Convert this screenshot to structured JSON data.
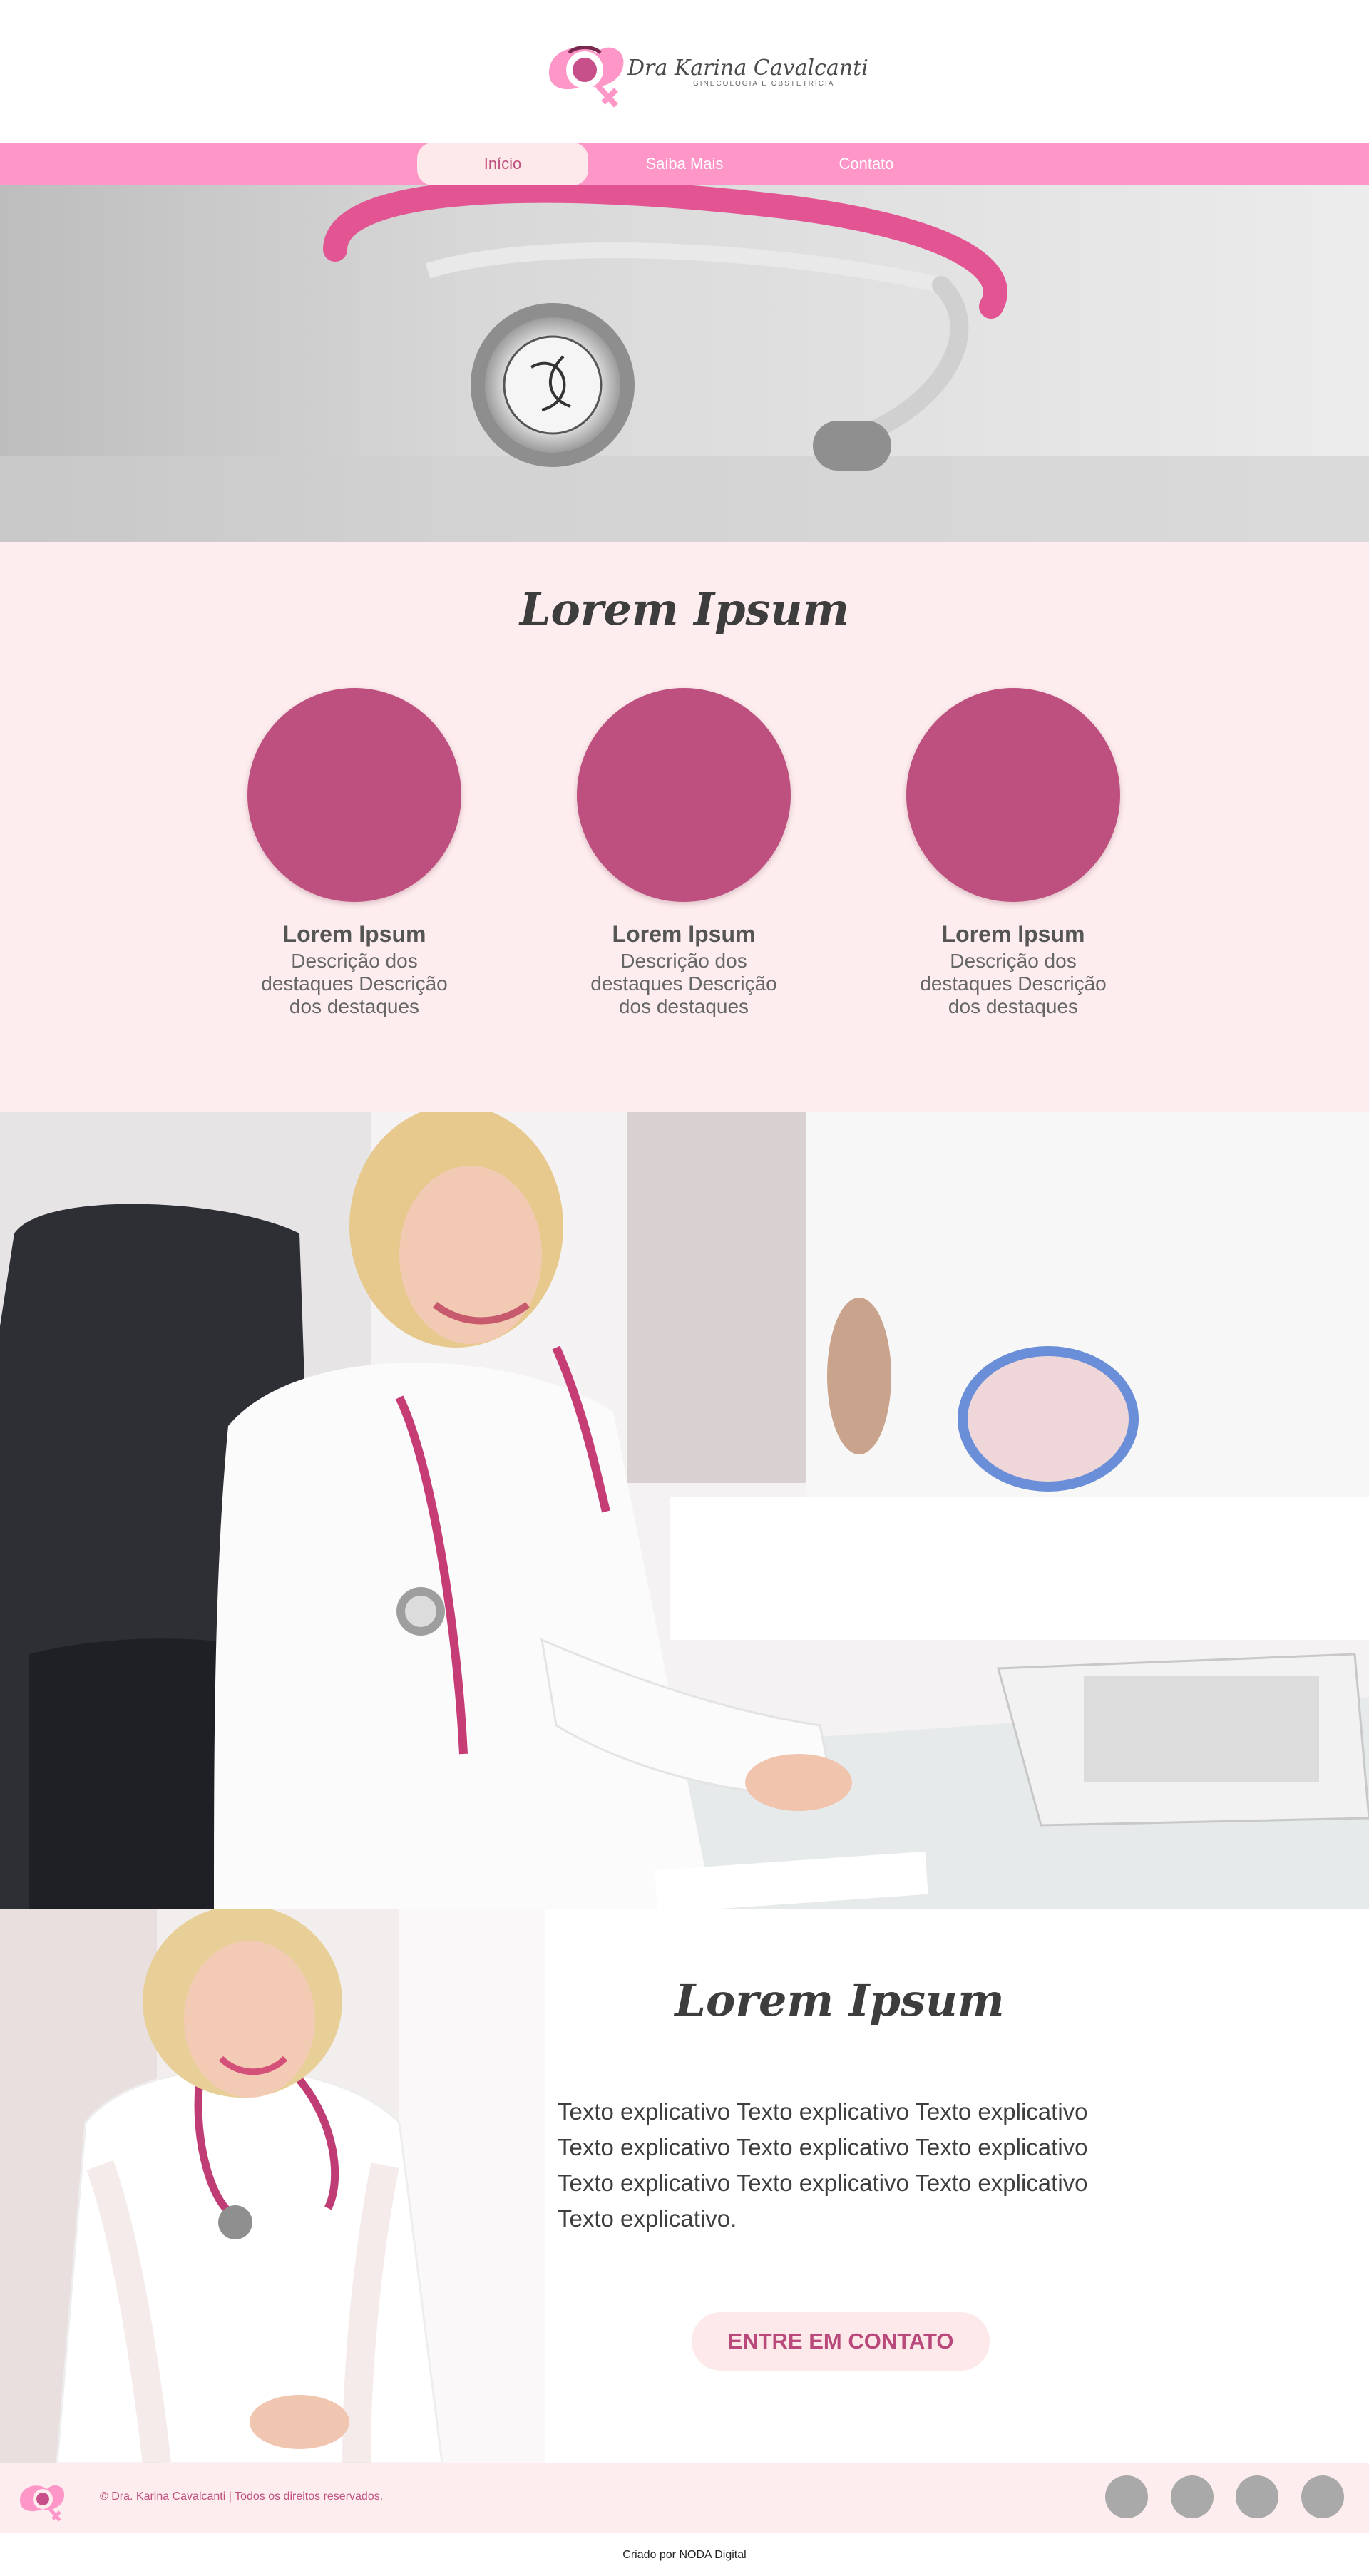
{
  "header": {
    "logo_title": "Dra Karina Cavalcanti",
    "logo_subtitle": "GINECOLOGIA E OBSTETRÍCIA"
  },
  "nav": {
    "items": [
      {
        "label": "Início",
        "active": true
      },
      {
        "label": "Saiba Mais",
        "active": false
      },
      {
        "label": "Contato",
        "active": false
      }
    ]
  },
  "features": {
    "title": "Lorem Ipsum",
    "items": [
      {
        "title": "Lorem Ipsum",
        "description": "Descrição dos destaques Descrição dos destaques"
      },
      {
        "title": "Lorem Ipsum",
        "description": "Descrição dos destaques Descrição dos destaques"
      },
      {
        "title": "Lorem Ipsum",
        "description": "Descrição dos destaques Descrição dos destaques"
      }
    ]
  },
  "about": {
    "title": "Lorem Ipsum",
    "text": "Texto explicativo Texto explicativo Texto explicativo Texto explicativo Texto explicativo Texto explicativo Texto explicativo Texto explicativo Texto explicativo Texto explicativo.",
    "cta_label": "ENTRE EM CONTATO"
  },
  "footer": {
    "copyright": "© Dra. Karina Cavalcanti | Todos os direitos reservados.",
    "credit": "Criado por NODA Digital"
  },
  "colors": {
    "nav_pink": "#ff96c8",
    "light_pink": "#fdedee",
    "magenta": "#bd507f",
    "social_gray": "#a9a9a9"
  }
}
